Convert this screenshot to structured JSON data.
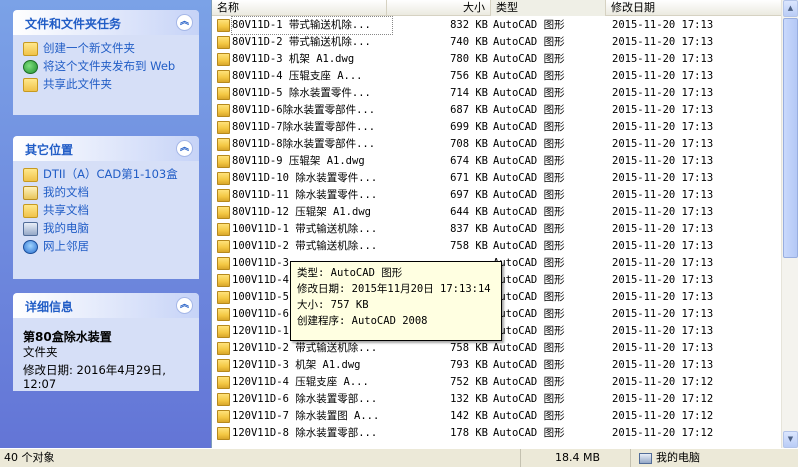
{
  "task_pane": {
    "file_tasks": {
      "title": "文件和文件夹任务",
      "items": [
        {
          "label": "创建一个新文件夹",
          "icon": "new-folder-icon"
        },
        {
          "label": "将这个文件夹发布到 Web",
          "icon": "publish-web-icon"
        },
        {
          "label": "共享此文件夹",
          "icon": "share-folder-icon"
        }
      ]
    },
    "other_places": {
      "title": "其它位置",
      "items": [
        {
          "label": "DTII（A）CAD第1-103盒",
          "icon": "folder-icon"
        },
        {
          "label": "我的文档",
          "icon": "my-documents-icon"
        },
        {
          "label": "共享文档",
          "icon": "shared-documents-icon"
        },
        {
          "label": "我的电脑",
          "icon": "my-computer-icon"
        },
        {
          "label": "网上邻居",
          "icon": "network-icon"
        }
      ]
    },
    "details": {
      "title": "详细信息",
      "name": "第80盒除水装置",
      "type": "文件夹",
      "modified": "修改日期: 2016年4月29日, 12:07"
    }
  },
  "file_list": {
    "columns": {
      "name": "名称",
      "size": "大小",
      "type": "类型",
      "modified": "修改日期"
    },
    "rows": [
      {
        "name": "80V11D-1   带式输送机除...",
        "size": "832 KB",
        "type": "AutoCAD 图形",
        "modified": "2015-11-20 17:13"
      },
      {
        "name": "80V11D-2   带式输送机除...",
        "size": "740 KB",
        "type": "AutoCAD 图形",
        "modified": "2015-11-20 17:13"
      },
      {
        "name": "80V11D-3   机架    A1.dwg",
        "size": "780 KB",
        "type": "AutoCAD 图形",
        "modified": "2015-11-20 17:13"
      },
      {
        "name": "80V11D-4   压辊支座    A...",
        "size": "756 KB",
        "type": "AutoCAD 图形",
        "modified": "2015-11-20 17:13"
      },
      {
        "name": "80V11D-5   除水装置零件...",
        "size": "714 KB",
        "type": "AutoCAD 图形",
        "modified": "2015-11-20 17:13"
      },
      {
        "name": "80V11D-6除水装置零部件...",
        "size": "687 KB",
        "type": "AutoCAD 图形",
        "modified": "2015-11-20 17:13"
      },
      {
        "name": "80V11D-7除水装置零部件...",
        "size": "699 KB",
        "type": "AutoCAD 图形",
        "modified": "2015-11-20 17:13"
      },
      {
        "name": "80V11D-8除水装置零部件...",
        "size": "708 KB",
        "type": "AutoCAD 图形",
        "modified": "2015-11-20 17:13"
      },
      {
        "name": "80V11D-9 压辊架   A1.dwg",
        "size": "674 KB",
        "type": "AutoCAD 图形",
        "modified": "2015-11-20 17:13"
      },
      {
        "name": "80V11D-10 除水装置零件...",
        "size": "671 KB",
        "type": "AutoCAD 图形",
        "modified": "2015-11-20 17:13"
      },
      {
        "name": "80V11D-11  除水装置零件...",
        "size": "697 KB",
        "type": "AutoCAD 图形",
        "modified": "2015-11-20 17:13"
      },
      {
        "name": "80V11D-12 压辊架    A1.dwg",
        "size": "644 KB",
        "type": "AutoCAD 图形",
        "modified": "2015-11-20 17:13"
      },
      {
        "name": "100V11D-1   带式输送机除...",
        "size": "837 KB",
        "type": "AutoCAD 图形",
        "modified": "2015-11-20 17:13"
      },
      {
        "name": "100V11D-2   带式输送机除...",
        "size": "758 KB",
        "type": "AutoCAD 图形",
        "modified": "2015-11-20 17:13"
      },
      {
        "name": "100V11D-3",
        "size": "",
        "type": "AutoCAD 图形",
        "modified": "2015-11-20 17:13"
      },
      {
        "name": "100V11D-4",
        "size": "",
        "type": "AutoCAD 图形",
        "modified": "2015-11-20 17:13"
      },
      {
        "name": "100V11D-5",
        "size": "",
        "type": "AutoCAD 图形",
        "modified": "2015-11-20 17:13"
      },
      {
        "name": "100V11D-6",
        "size": "",
        "type": "AutoCAD 图形",
        "modified": "2015-11-20 17:13"
      },
      {
        "name": "120V11D-1",
        "size": "",
        "type": "AutoCAD 图形",
        "modified": "2015-11-20 17:13"
      },
      {
        "name": "120V11D-2   带式输送机除...",
        "size": "758 KB",
        "type": "AutoCAD 图形",
        "modified": "2015-11-20 17:13"
      },
      {
        "name": "120V11D-3   机架    A1.dwg",
        "size": "793 KB",
        "type": "AutoCAD 图形",
        "modified": "2015-11-20 17:13"
      },
      {
        "name": "120V11D-4   压辊支座    A...",
        "size": "752 KB",
        "type": "AutoCAD 图形",
        "modified": "2015-11-20 17:12"
      },
      {
        "name": "120V11D-6 除水装置零部...",
        "size": "132 KB",
        "type": "AutoCAD 图形",
        "modified": "2015-11-20 17:12"
      },
      {
        "name": "120V11D-7   除水装置图 A...",
        "size": "142 KB",
        "type": "AutoCAD 图形",
        "modified": "2015-11-20 17:12"
      },
      {
        "name": "120V11D-8 除水装置零部...",
        "size": "178 KB",
        "type": "AutoCAD 图形",
        "modified": "2015-11-20 17:12"
      }
    ]
  },
  "tooltip": {
    "type_line": "类型: AutoCAD 图形",
    "modified_line": "修改日期: 2015年11月20日 17:13:14",
    "size_line": "大小: 757 KB",
    "creator_line": "创建程序: AutoCAD 2008"
  },
  "status_bar": {
    "count": "40 个对象",
    "size": "18.4 MB",
    "location": "我的电脑"
  },
  "scrollbar": {
    "up": "▲",
    "down": "▼"
  },
  "collapse_glyph": "︽",
  "colors": {
    "pane_top": "#7ba2e7",
    "pane_bottom": "#6375d6",
    "link": "#215dc6",
    "tooltip_bg": "#ffffe1"
  }
}
